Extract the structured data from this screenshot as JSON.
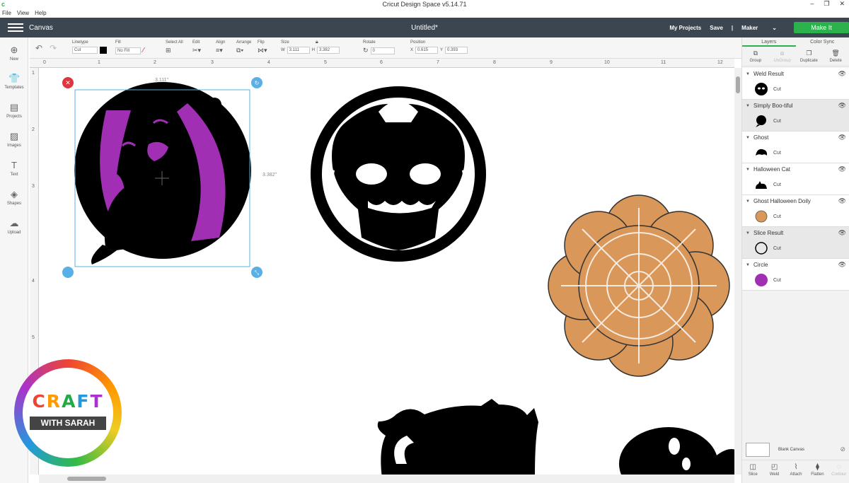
{
  "window": {
    "title": "Cricut Design Space  v5.14.71",
    "app_icon": "c"
  },
  "menu": [
    "File",
    "View",
    "Help"
  ],
  "header": {
    "canvas_label": "Canvas",
    "doc_title": "Untitled*",
    "my_projects": "My Projects",
    "save": "Save",
    "separator": "|",
    "machine": "Maker",
    "make_it": "Make It",
    "accent": "#2bb24c",
    "bg": "#3c4650"
  },
  "toolbar": {
    "linetype_label": "Linetype",
    "linetype_value": "Cut",
    "fill_label": "Fill",
    "fill_value": "No Fill",
    "select_all": "Select All",
    "edit": "Edit",
    "align": "Align",
    "arrange": "Arrange",
    "flip": "Flip",
    "size": "Size",
    "w_label": "W",
    "w_value": "3.111",
    "h_label": "H",
    "h_value": "3.382",
    "rotate": "Rotate",
    "rotate_value": "0",
    "position": "Position",
    "x_label": "X",
    "x_value": "0.615",
    "y_label": "Y",
    "y_value": "0.393"
  },
  "leftbar": [
    "New",
    "Templates",
    "Projects",
    "Images",
    "Text",
    "Shapes",
    "Upload"
  ],
  "ruler_top": [
    "0",
    "1",
    "2",
    "3",
    "4",
    "5",
    "6",
    "7",
    "8",
    "9",
    "10",
    "11",
    "12"
  ],
  "ruler_left": [
    "1",
    "2",
    "3",
    "4",
    "5"
  ],
  "selection": {
    "width_label": "3.111\"",
    "height_label": "3.382\""
  },
  "panel": {
    "tabs": [
      "Layers",
      "Color Sync"
    ],
    "tools": [
      "Group",
      "UnGroup",
      "Duplicate",
      "Delete"
    ],
    "layers": [
      {
        "name": "Weld Result",
        "op": "Cut",
        "thumb": "pumpkin-icon"
      },
      {
        "name": "Simply Boo-tiful",
        "op": "Cut",
        "thumb": "ghost-icon"
      },
      {
        "name": "Ghost",
        "op": "Cut",
        "thumb": "ghost-icon"
      },
      {
        "name": "Halloween Cat",
        "op": "Cut",
        "thumb": "cat-icon"
      },
      {
        "name": "Ghost Halloween Doily",
        "op": "Cut",
        "thumb": "doily-icon"
      },
      {
        "name": "Slice Result",
        "op": "Cut",
        "thumb": "circle-outline-icon"
      },
      {
        "name": "Circle",
        "op": "Cut",
        "thumb": "circle-icon"
      }
    ],
    "blank_canvas": "Blank Canvas",
    "bottom_tools": [
      "Slice",
      "Weld",
      "Attach",
      "Flatten",
      "Contour"
    ]
  },
  "colors": {
    "purple": "#a02fb4",
    "doily": "#d9975a"
  },
  "logo": {
    "craft": [
      "C",
      "R",
      "A",
      "F",
      "T"
    ],
    "with_sarah": "WITH SARAH"
  }
}
